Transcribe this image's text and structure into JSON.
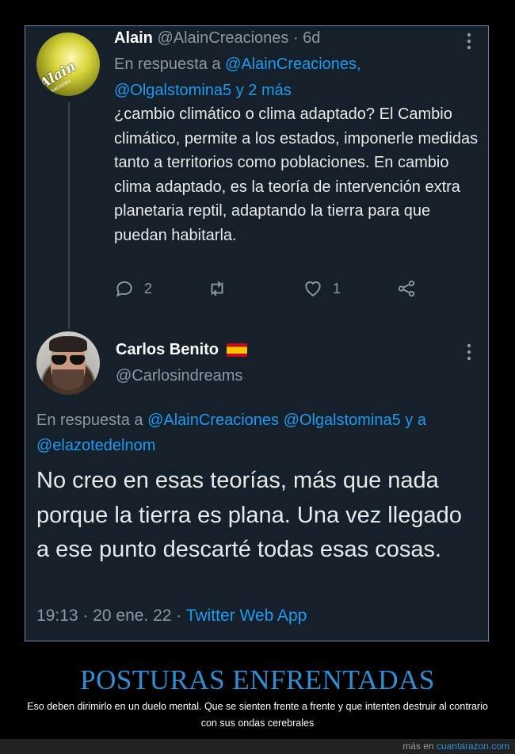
{
  "tweet1": {
    "name": "Alain",
    "handle": "@AlainCreaciones",
    "time": "· 6d",
    "reply_prefix": "En respuesta a",
    "reply_mentions_line1": "@AlainCreaciones,",
    "reply_mentions_line2": "@Olgalstomina5 y 2 más",
    "body": "¿cambio climático o clima adaptado? El Cambio climático, permite a los estados, imponerle medidas tanto a territorios como poblaciones. En cambio clima adaptado, es la teoría de intervención extra planetaria reptil, adaptando la tierra para que puedan habitarla.",
    "replies_count": "2",
    "likes_count": "1",
    "avatar_text": "Alain",
    "avatar_subtext": "Creaciones"
  },
  "tweet2": {
    "name": "Carlos Benito",
    "handle": "@Carlosindreams",
    "reply_prefix": "En respuesta a",
    "reply_mentions": "@AlainCreaciones @Olgalstomina5 y a @elazotedelnom",
    "body": "No creo en esas teorías, más que nada porque la tierra es plana. Una vez llegado a ese punto descarté todas esas cosas.",
    "time": "19:13 · 20 ene. 22 ·",
    "source": "Twitter Web App"
  },
  "caption": {
    "title": "POSTURAS ENFRENTADAS",
    "text": "Eso deben dirimirlo en un duelo mental. Que se sienten frente a frente y que intenten destruir al contrario con sus ondas cerebrales"
  },
  "footer": {
    "prefix": "más en",
    "site": "cuantarazon.com"
  },
  "colors": {
    "background": "#15202b",
    "accent": "#1d9bf0",
    "muted": "#8b98a5",
    "caption_title": "#2d8fd5"
  },
  "icons": [
    "more-icon",
    "reply-icon",
    "retweet-icon",
    "like-icon",
    "share-icon",
    "spain-flag-icon"
  ]
}
